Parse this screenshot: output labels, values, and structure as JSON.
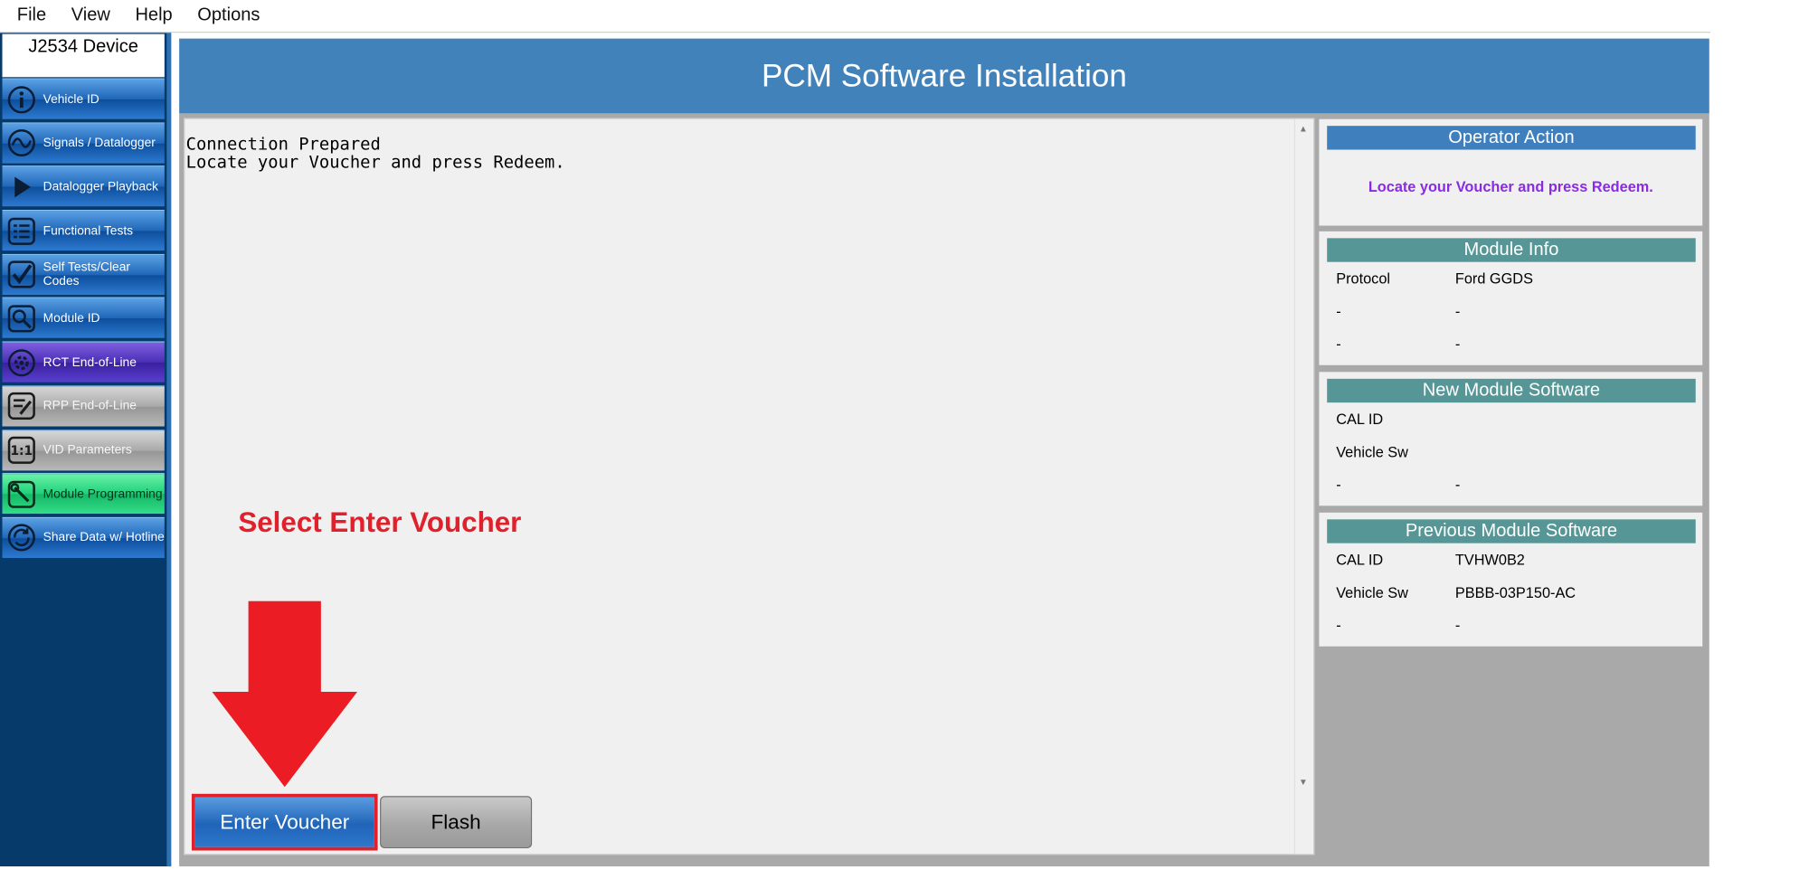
{
  "menu": [
    "File",
    "View",
    "Help",
    "Options"
  ],
  "sidebar": {
    "device_label": "J2534 Device",
    "items": [
      {
        "label": "Vehicle ID",
        "icon": "info-icon",
        "style": "blue"
      },
      {
        "label": "Signals / Datalogger",
        "icon": "signal-icon",
        "style": "blue"
      },
      {
        "label": "Datalogger Playback",
        "icon": "play-icon",
        "style": "blue"
      },
      {
        "label": "Functional Tests",
        "icon": "list-icon",
        "style": "blue"
      },
      {
        "label": "Self Tests/Clear Codes",
        "icon": "checkmark-icon",
        "style": "blue"
      },
      {
        "label": "Module ID",
        "icon": "magnifier-icon",
        "style": "blue"
      },
      {
        "label": "RCT End-of-Line",
        "icon": "gear-icon",
        "style": "purple"
      },
      {
        "label": "RPP End-of-Line",
        "icon": "edit-icon",
        "style": "gray"
      },
      {
        "label": "VID Parameters",
        "icon": "ratio-icon",
        "style": "gray"
      },
      {
        "label": "Module Programming",
        "icon": "wrench-icon",
        "style": "green"
      },
      {
        "label": "Share Data w/ Hotline",
        "icon": "refresh-icon",
        "style": "blue"
      }
    ]
  },
  "header": {
    "title": "PCM Software Installation"
  },
  "log": {
    "lines": "Connection Prepared\nLocate your Voucher and press Redeem."
  },
  "annotation": {
    "text": "Select Enter Voucher",
    "color": "#e0202a"
  },
  "buttons": {
    "enter_voucher": "Enter Voucher",
    "flash": "Flash"
  },
  "operator_action": {
    "title": "Operator Action",
    "message": "Locate your Voucher and press Redeem.",
    "message_color": "#8a2be2"
  },
  "module_info": {
    "title": "Module Info",
    "rows": [
      {
        "key": "Protocol",
        "value": "Ford GGDS"
      },
      {
        "key": "-",
        "value": "-"
      },
      {
        "key": "-",
        "value": "-"
      }
    ]
  },
  "new_software": {
    "title": "New Module Software",
    "rows": [
      {
        "key": "CAL ID",
        "value": ""
      },
      {
        "key": "Vehicle Sw",
        "value": ""
      },
      {
        "key": "-",
        "value": "-"
      }
    ]
  },
  "previous_software": {
    "title": "Previous Module Software",
    "rows": [
      {
        "key": "CAL ID",
        "value": "TVHW0B2"
      },
      {
        "key": "Vehicle Sw",
        "value": "PBBB-03P150-AC"
      },
      {
        "key": "-",
        "value": "-"
      }
    ]
  },
  "colors": {
    "header_blue": "#4282ba",
    "sidebar_navy": "#053a6a",
    "highlight_red": "#e0202a",
    "title_teal": "#569696"
  }
}
